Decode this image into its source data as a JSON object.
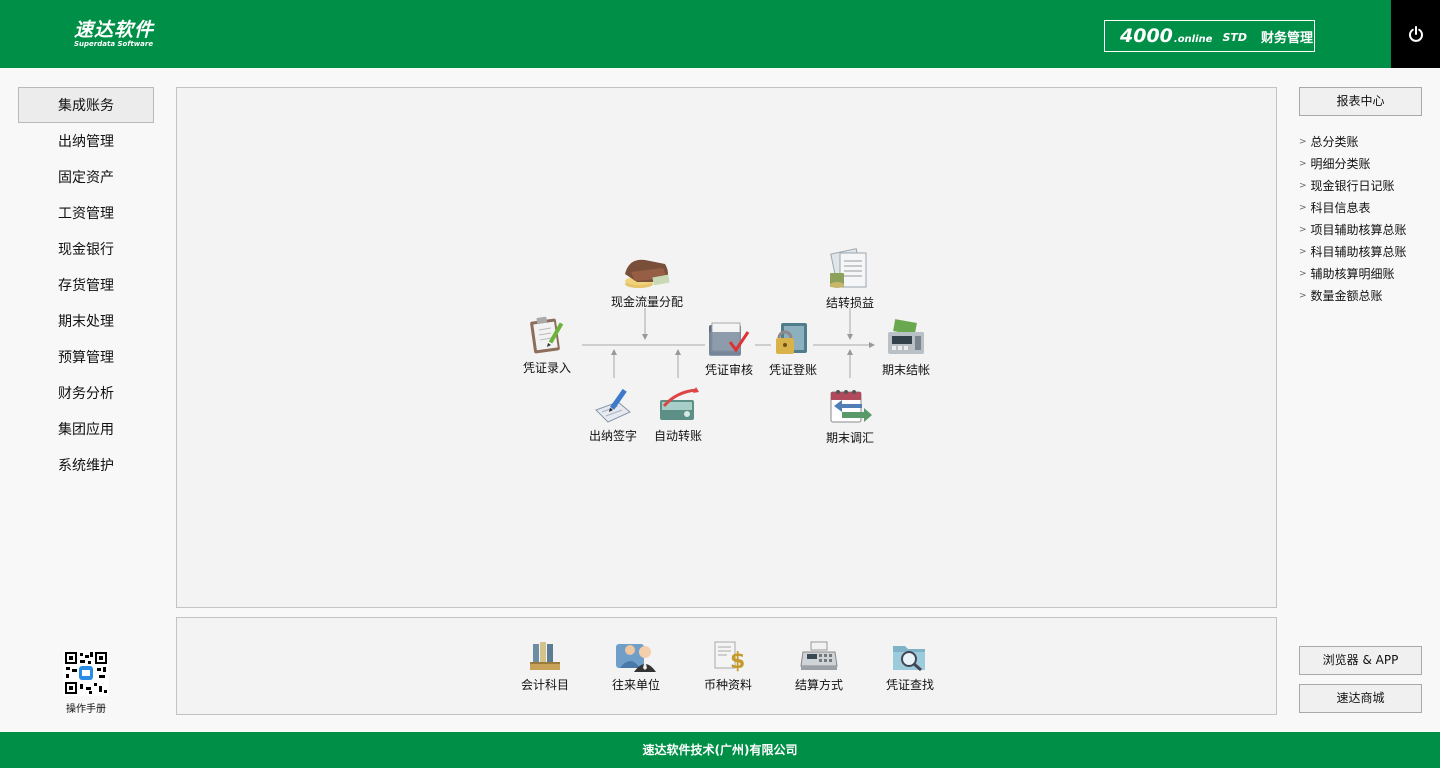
{
  "header": {
    "logo_cn": "速达软件",
    "logo_en": "Superdata Software",
    "product_num": "4000",
    "product_online": ".online",
    "product_edition": "STD",
    "product_name": "财务管理",
    "power_icon": "power-icon"
  },
  "left_nav": {
    "items": [
      "集成账务",
      "出纳管理",
      "固定资产",
      "工资管理",
      "现金银行",
      "存货管理",
      "期末处理",
      "预算管理",
      "财务分析",
      "集团应用",
      "系统维护"
    ],
    "active_index": 0
  },
  "qr": {
    "label": "操作手册"
  },
  "workflow": {
    "voucher_entry": "凭证录入",
    "cash_flow": "现金流量分配",
    "cashier_sign": "出纳签字",
    "auto_transfer": "自动转账",
    "voucher_audit": "凭证审核",
    "voucher_post": "凭证登账",
    "profit_transfer": "结转损益",
    "period_adjust": "期末调汇",
    "period_close": "期末结帐"
  },
  "tools": {
    "items": [
      "会计科目",
      "往来单位",
      "币种资料",
      "结算方式",
      "凭证查找"
    ]
  },
  "right": {
    "report_center": "报表中心",
    "reports": [
      "总分类账",
      "明细分类账",
      "现金银行日记账",
      "科目信息表",
      "项目辅助核算总账",
      "科目辅助核算总账",
      "辅助核算明细账",
      "数量金额总账"
    ],
    "browser_app": "浏览器 & APP",
    "mall": "速达商城"
  },
  "footer": {
    "company": "速达软件技术(广州)有限公司"
  },
  "colors": {
    "brand_green": "#008f47",
    "power_bg": "#000000"
  }
}
